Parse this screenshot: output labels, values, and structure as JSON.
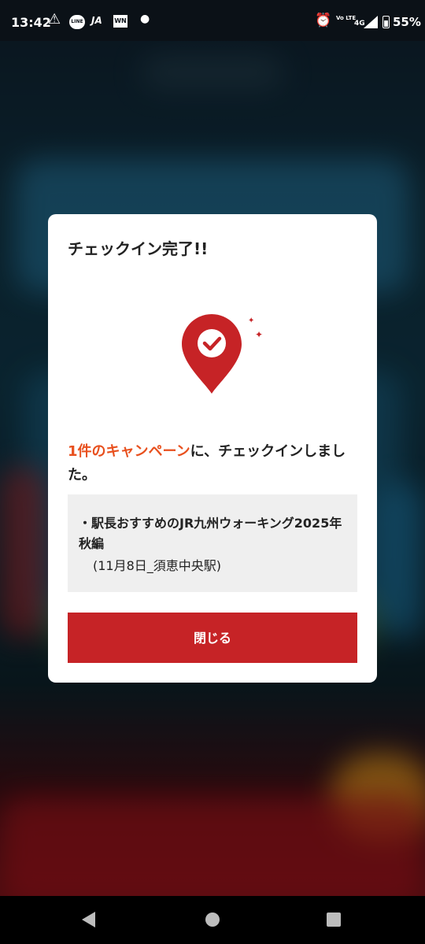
{
  "status_bar": {
    "time": "13:42",
    "line_label": "LINE",
    "ja_label": "JA",
    "wn_label": "WN",
    "volte_label": "Vo LTE",
    "network": "4G",
    "battery": "55%"
  },
  "dialog": {
    "title": "チェックイン完了!!",
    "icon": "location-pin-check-icon",
    "message_highlight": "1件のキャンペーン",
    "message_rest": "に、チェックインしました。",
    "campaign_name": "・駅長おすすめのJR九州ウォーキング2025年秋編",
    "campaign_detail": "(11月8日_須恵中央駅)",
    "close_label": "閉じる"
  },
  "colors": {
    "accent_red": "#c62326",
    "highlight_orange": "#e8501e",
    "text_dark": "#222222",
    "box_gray": "#efefef"
  },
  "nav": {
    "back_icon": "back-triangle-icon",
    "home_icon": "home-circle-icon",
    "recents_icon": "recents-square-icon"
  }
}
